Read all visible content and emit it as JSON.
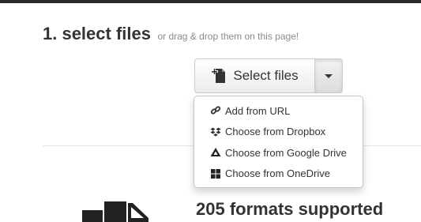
{
  "heading": {
    "main": "1. select files",
    "sub": "or drag & drop them on this page!"
  },
  "select_button": {
    "label": "Select files",
    "icon": "file-add-icon"
  },
  "dropdown": {
    "items": [
      {
        "label": "Add from URL",
        "icon": "link-icon"
      },
      {
        "label": "Choose from Dropbox",
        "icon": "dropbox-icon"
      },
      {
        "label": "Choose from Google Drive",
        "icon": "google-drive-icon"
      },
      {
        "label": "Choose from OneDrive",
        "icon": "onedrive-icon"
      }
    ]
  },
  "formats": {
    "title": "205 formats supported"
  },
  "colors": {
    "top_bar": "#2b2b2b",
    "text": "#333333",
    "muted": "#8a8a8a"
  }
}
